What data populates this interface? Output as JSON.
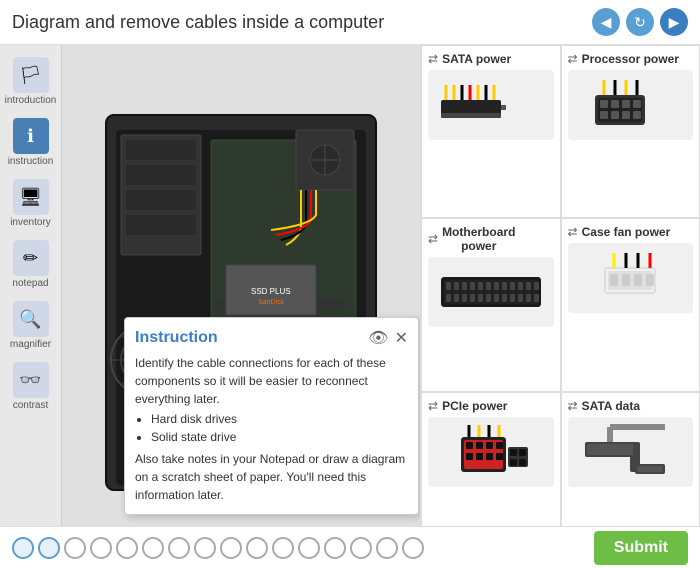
{
  "header": {
    "title": "Diagram and remove cables inside a computer",
    "nav": {
      "prev_label": "◀",
      "refresh_label": "↻",
      "next_label": "▶"
    }
  },
  "sidebar": {
    "items": [
      {
        "id": "introduction",
        "label": "introduction",
        "icon": "🏳",
        "active": false
      },
      {
        "id": "instruction",
        "label": "instruction",
        "icon": "ℹ",
        "active": true
      },
      {
        "id": "inventory",
        "label": "inventory",
        "icon": "🖥",
        "active": false
      },
      {
        "id": "notepad",
        "label": "notepad",
        "icon": "✏",
        "active": false
      },
      {
        "id": "magnifier",
        "label": "magnifier",
        "icon": "🔍",
        "active": false
      },
      {
        "id": "contrast",
        "label": "contrast",
        "icon": "👓",
        "active": false
      }
    ]
  },
  "cables": [
    {
      "id": "sata-power",
      "label": "SATA power",
      "color": "#f0a020"
    },
    {
      "id": "processor-power",
      "label": "Processor power",
      "color": "#f0a020"
    },
    {
      "id": "motherboard-power",
      "label": "Motherboard power",
      "color": "#4a4a8a"
    },
    {
      "id": "case-fan-power",
      "label": "Case fan power",
      "color": "#f0f050"
    },
    {
      "id": "pcie-power",
      "label": "PCIe power",
      "color": "#cc2222"
    },
    {
      "id": "sata-data",
      "label": "SATA data",
      "color": "#888888"
    }
  ],
  "instruction": {
    "title": "Instruction",
    "content_intro": "Identify the cable connections for each of these components so it will be easier to reconnect everything later.",
    "bullets": [
      "Hard disk drives",
      "Solid state drive"
    ],
    "content_extra": "Also take notes in your Notepad or draw a diagram on a scratch sheet of paper. You'll need this information later."
  },
  "bottom": {
    "submit_label": "Submit",
    "dots": [
      {
        "active": true
      },
      {
        "active": true
      },
      {
        "active": false
      },
      {
        "active": false
      },
      {
        "active": false
      },
      {
        "active": false
      },
      {
        "active": false
      },
      {
        "active": false
      },
      {
        "active": false
      },
      {
        "active": false
      },
      {
        "active": false
      },
      {
        "active": false
      },
      {
        "active": false
      },
      {
        "active": false
      },
      {
        "active": false
      },
      {
        "active": false
      }
    ]
  }
}
